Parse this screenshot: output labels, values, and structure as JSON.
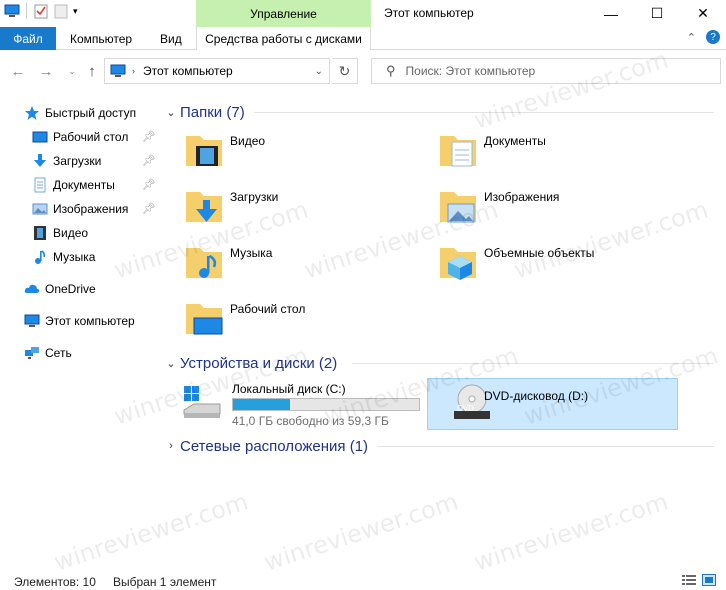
{
  "window": {
    "title": "Этот компьютер",
    "context_tab_header": "Управление",
    "minimize": "—",
    "maximize": "☐",
    "close": "✕"
  },
  "ribbon": {
    "tabs": [
      "Файл",
      "Компьютер",
      "Вид"
    ],
    "context_tab": "Средства работы с дисками",
    "accent": "#1979ca",
    "context_color": "#c5f0b0"
  },
  "address": {
    "path": "Этот компьютер",
    "search_placeholder": "Поиск: Этот компьютер"
  },
  "nav": {
    "quick_access": "Быстрый доступ",
    "pinned": [
      {
        "label": "Рабочий стол",
        "icon": "desktop-icon"
      },
      {
        "label": "Загрузки",
        "icon": "downloads-icon"
      },
      {
        "label": "Документы",
        "icon": "documents-icon"
      },
      {
        "label": "Изображения",
        "icon": "pictures-icon"
      }
    ],
    "unpinned": [
      {
        "label": "Видео",
        "icon": "video-icon"
      },
      {
        "label": "Музыка",
        "icon": "music-icon"
      }
    ],
    "onedrive": "OneDrive",
    "this_pc": "Этот компьютер",
    "network": "Сеть"
  },
  "content": {
    "folders_header": "Папки (7)",
    "folders": [
      {
        "label": "Видео",
        "icon": "video-folder-icon"
      },
      {
        "label": "Документы",
        "icon": "documents-folder-icon"
      },
      {
        "label": "Загрузки",
        "icon": "downloads-folder-icon"
      },
      {
        "label": "Изображения",
        "icon": "pictures-folder-icon"
      },
      {
        "label": "Музыка",
        "icon": "music-folder-icon"
      },
      {
        "label": "Объемные объекты",
        "icon": "3d-objects-folder-icon"
      },
      {
        "label": "Рабочий стол",
        "icon": "desktop-folder-icon"
      }
    ],
    "devices_header": "Устройства и диски (2)",
    "drives": [
      {
        "label": "Локальный диск (C:)",
        "free_text": "41,0 ГБ свободно из 59,3 ГБ",
        "used_fraction": 0.309
      },
      {
        "label": "DVD-дисковод (D:)",
        "dvd_badge": "DVD"
      }
    ],
    "network_header": "Сетевые расположения (1)"
  },
  "status": {
    "items": "Элементов: 10",
    "selected": "Выбран 1 элемент"
  },
  "watermark": "winreviewer.com"
}
